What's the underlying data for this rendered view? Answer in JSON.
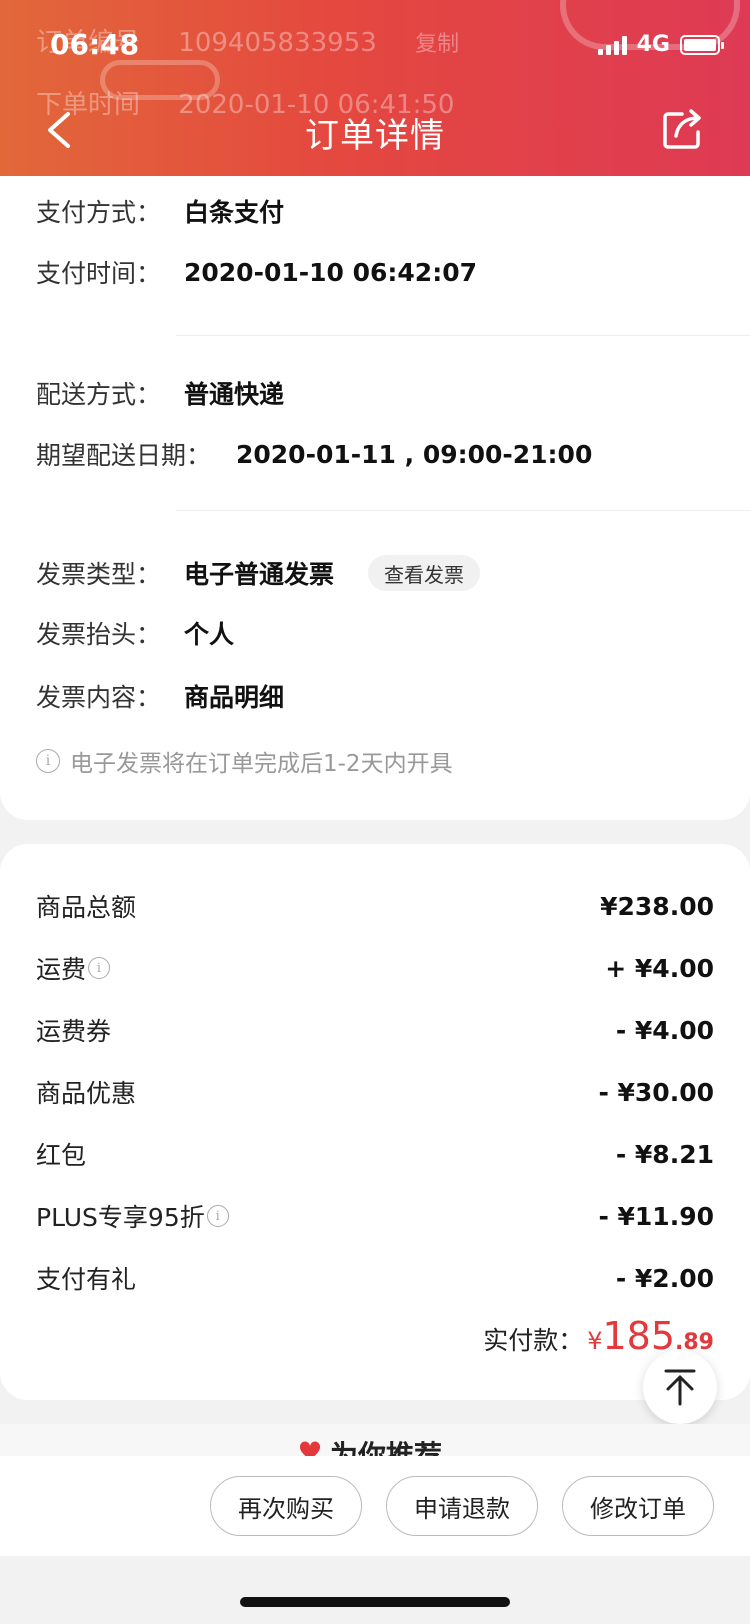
{
  "status_bar": {
    "time": "06:48",
    "network": "4G"
  },
  "header": {
    "title": "订单详情",
    "ghost_line1_label": "订单编号",
    "ghost_line1_value": "109405833953",
    "ghost_line1_action": "复制",
    "ghost_line2_label": "下单时间",
    "ghost_line2_value": "2020-01-10 06:41:50"
  },
  "payment": {
    "method_label": "支付方式：",
    "method_value": "白条支付",
    "time_label": "支付时间：",
    "time_value": "2020-01-10 06:42:07"
  },
  "delivery": {
    "method_label": "配送方式：",
    "method_value": "普通快递",
    "date_label": "期望配送日期：",
    "date_value": "2020-01-11 , 09:00-21:00"
  },
  "invoice": {
    "type_label": "发票类型：",
    "type_value": "电子普通发票",
    "view_button": "查看发票",
    "title_label": "发票抬头：",
    "title_value": "个人",
    "content_label": "发票内容：",
    "content_value": "商品明细",
    "note": "电子发票将在订单完成后1-2天内开具"
  },
  "fees": [
    {
      "label": "商品总额",
      "value": "¥238.00",
      "info": false
    },
    {
      "label": "运费",
      "value": "+ ¥4.00",
      "info": true
    },
    {
      "label": "运费券",
      "value": "- ¥4.00",
      "info": false
    },
    {
      "label": "商品优惠",
      "value": "- ¥30.00",
      "info": false
    },
    {
      "label": "红包",
      "value": "- ¥8.21",
      "info": false
    },
    {
      "label": "PLUS专享95折",
      "value": "- ¥11.90",
      "info": true
    },
    {
      "label": "支付有礼",
      "value": "- ¥2.00",
      "info": false
    }
  ],
  "total": {
    "label": "实付款：",
    "currency": "¥",
    "integer": "185",
    "decimal": ".89"
  },
  "recommend": {
    "title": "为你推荐"
  },
  "actions": {
    "rebuy": "再次购买",
    "refund": "申请退款",
    "modify": "修改订单"
  },
  "colors": {
    "header_start": "#e2683a",
    "header_end": "#de3a55",
    "price_red": "#e4393c"
  }
}
